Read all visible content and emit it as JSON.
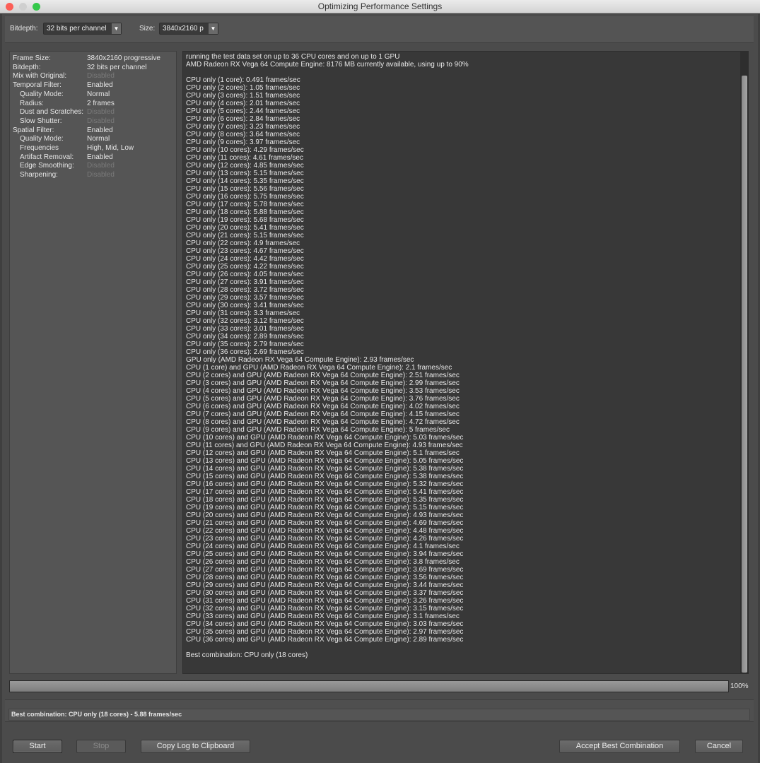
{
  "window": {
    "title": "Optimizing Performance Settings"
  },
  "toolbar": {
    "bitdepth_label": "Bitdepth:",
    "bitdepth_value": "32 bits per channel",
    "size_label": "Size:",
    "size_value": "3840x2160 p"
  },
  "settings": [
    {
      "key": "Frame Size:",
      "value": "3840x2160 progressive",
      "sub": false,
      "disabled": false
    },
    {
      "key": "Bitdepth:",
      "value": "32 bits per channel",
      "sub": false,
      "disabled": false
    },
    {
      "key": "Mix with Original:",
      "value": "Disabled",
      "sub": false,
      "disabled": true
    },
    {
      "key": "Temporal Filter:",
      "value": "Enabled",
      "sub": false,
      "disabled": false
    },
    {
      "key": "Quality Mode:",
      "value": "Normal",
      "sub": true,
      "disabled": false
    },
    {
      "key": "Radius:",
      "value": "2 frames",
      "sub": true,
      "disabled": false
    },
    {
      "key": "Dust and Scratches:",
      "value": "Disabled",
      "sub": true,
      "disabled": true
    },
    {
      "key": "Slow Shutter:",
      "value": "Disabled",
      "sub": true,
      "disabled": true
    },
    {
      "key": "Spatial Filter:",
      "value": "Enabled",
      "sub": false,
      "disabled": false
    },
    {
      "key": "Quality Mode:",
      "value": "Normal",
      "sub": true,
      "disabled": false
    },
    {
      "key": "Frequencies",
      "value": "High, Mid, Low",
      "sub": true,
      "disabled": false
    },
    {
      "key": "Artifact Removal:",
      "value": "Enabled",
      "sub": true,
      "disabled": false
    },
    {
      "key": "Edge Smoothing:",
      "value": "Disabled",
      "sub": true,
      "disabled": true
    },
    {
      "key": "Sharpening:",
      "value": "Disabled",
      "sub": true,
      "disabled": true
    }
  ],
  "log": {
    "lines": [
      "running the test data set on up to 36 CPU cores and on up to 1 GPU",
      "AMD Radeon RX Vega 64 Compute Engine: 8176 MB currently available, using up to 90%",
      "",
      "CPU only (1 core): 0.491 frames/sec",
      "CPU only (2 cores): 1.05 frames/sec",
      "CPU only (3 cores): 1.51 frames/sec",
      "CPU only (4 cores): 2.01 frames/sec",
      "CPU only (5 cores): 2.44 frames/sec",
      "CPU only (6 cores): 2.84 frames/sec",
      "CPU only (7 cores): 3.23 frames/sec",
      "CPU only (8 cores): 3.64 frames/sec",
      "CPU only (9 cores): 3.97 frames/sec",
      "CPU only (10 cores): 4.29 frames/sec",
      "CPU only (11 cores): 4.61 frames/sec",
      "CPU only (12 cores): 4.85 frames/sec",
      "CPU only (13 cores): 5.15 frames/sec",
      "CPU only (14 cores): 5.35 frames/sec",
      "CPU only (15 cores): 5.56 frames/sec",
      "CPU only (16 cores): 5.75 frames/sec",
      "CPU only (17 cores): 5.78 frames/sec",
      "CPU only (18 cores): 5.88 frames/sec",
      "CPU only (19 cores): 5.68 frames/sec",
      "CPU only (20 cores): 5.41 frames/sec",
      "CPU only (21 cores): 5.15 frames/sec",
      "CPU only (22 cores): 4.9 frames/sec",
      "CPU only (23 cores): 4.67 frames/sec",
      "CPU only (24 cores): 4.42 frames/sec",
      "CPU only (25 cores): 4.22 frames/sec",
      "CPU only (26 cores): 4.05 frames/sec",
      "CPU only (27 cores): 3.91 frames/sec",
      "CPU only (28 cores): 3.72 frames/sec",
      "CPU only (29 cores): 3.57 frames/sec",
      "CPU only (30 cores): 3.41 frames/sec",
      "CPU only (31 cores): 3.3 frames/sec",
      "CPU only (32 cores): 3.12 frames/sec",
      "CPU only (33 cores): 3.01 frames/sec",
      "CPU only (34 cores): 2.89 frames/sec",
      "CPU only (35 cores): 2.79 frames/sec",
      "CPU only (36 cores): 2.69 frames/sec",
      "GPU only (AMD Radeon RX Vega 64 Compute Engine): 2.93 frames/sec",
      "CPU (1 core) and GPU (AMD Radeon RX Vega 64 Compute Engine): 2.1 frames/sec",
      "CPU (2 cores) and GPU (AMD Radeon RX Vega 64 Compute Engine): 2.51 frames/sec",
      "CPU (3 cores) and GPU (AMD Radeon RX Vega 64 Compute Engine): 2.99 frames/sec",
      "CPU (4 cores) and GPU (AMD Radeon RX Vega 64 Compute Engine): 3.53 frames/sec",
      "CPU (5 cores) and GPU (AMD Radeon RX Vega 64 Compute Engine): 3.76 frames/sec",
      "CPU (6 cores) and GPU (AMD Radeon RX Vega 64 Compute Engine): 4.02 frames/sec",
      "CPU (7 cores) and GPU (AMD Radeon RX Vega 64 Compute Engine): 4.15 frames/sec",
      "CPU (8 cores) and GPU (AMD Radeon RX Vega 64 Compute Engine): 4.72 frames/sec",
      "CPU (9 cores) and GPU (AMD Radeon RX Vega 64 Compute Engine): 5 frames/sec",
      "CPU (10 cores) and GPU (AMD Radeon RX Vega 64 Compute Engine): 5.03 frames/sec",
      "CPU (11 cores) and GPU (AMD Radeon RX Vega 64 Compute Engine): 4.93 frames/sec",
      "CPU (12 cores) and GPU (AMD Radeon RX Vega 64 Compute Engine): 5.1 frames/sec",
      "CPU (13 cores) and GPU (AMD Radeon RX Vega 64 Compute Engine): 5.05 frames/sec",
      "CPU (14 cores) and GPU (AMD Radeon RX Vega 64 Compute Engine): 5.38 frames/sec",
      "CPU (15 cores) and GPU (AMD Radeon RX Vega 64 Compute Engine): 5.38 frames/sec",
      "CPU (16 cores) and GPU (AMD Radeon RX Vega 64 Compute Engine): 5.32 frames/sec",
      "CPU (17 cores) and GPU (AMD Radeon RX Vega 64 Compute Engine): 5.41 frames/sec",
      "CPU (18 cores) and GPU (AMD Radeon RX Vega 64 Compute Engine): 5.35 frames/sec",
      "CPU (19 cores) and GPU (AMD Radeon RX Vega 64 Compute Engine): 5.15 frames/sec",
      "CPU (20 cores) and GPU (AMD Radeon RX Vega 64 Compute Engine): 4.93 frames/sec",
      "CPU (21 cores) and GPU (AMD Radeon RX Vega 64 Compute Engine): 4.69 frames/sec",
      "CPU (22 cores) and GPU (AMD Radeon RX Vega 64 Compute Engine): 4.48 frames/sec",
      "CPU (23 cores) and GPU (AMD Radeon RX Vega 64 Compute Engine): 4.26 frames/sec",
      "CPU (24 cores) and GPU (AMD Radeon RX Vega 64 Compute Engine): 4.1 frames/sec",
      "CPU (25 cores) and GPU (AMD Radeon RX Vega 64 Compute Engine): 3.94 frames/sec",
      "CPU (26 cores) and GPU (AMD Radeon RX Vega 64 Compute Engine): 3.8 frames/sec",
      "CPU (27 cores) and GPU (AMD Radeon RX Vega 64 Compute Engine): 3.69 frames/sec",
      "CPU (28 cores) and GPU (AMD Radeon RX Vega 64 Compute Engine): 3.56 frames/sec",
      "CPU (29 cores) and GPU (AMD Radeon RX Vega 64 Compute Engine): 3.44 frames/sec",
      "CPU (30 cores) and GPU (AMD Radeon RX Vega 64 Compute Engine): 3.37 frames/sec",
      "CPU (31 cores) and GPU (AMD Radeon RX Vega 64 Compute Engine): 3.26 frames/sec",
      "CPU (32 cores) and GPU (AMD Radeon RX Vega 64 Compute Engine): 3.15 frames/sec",
      "CPU (33 cores) and GPU (AMD Radeon RX Vega 64 Compute Engine): 3.1 frames/sec",
      "CPU (34 cores) and GPU (AMD Radeon RX Vega 64 Compute Engine): 3.03 frames/sec",
      "CPU (35 cores) and GPU (AMD Radeon RX Vega 64 Compute Engine): 2.97 frames/sec",
      "CPU (36 cores) and GPU (AMD Radeon RX Vega 64 Compute Engine): 2.89 frames/sec",
      "",
      "Best combination: CPU only (18 cores)"
    ]
  },
  "progress": {
    "percent": 100,
    "label": "100%"
  },
  "status": {
    "text": "Best combination: CPU only (18 cores) - 5.88 frames/sec"
  },
  "buttons": {
    "start": "Start",
    "stop": "Stop",
    "copy_log": "Copy Log to Clipboard",
    "accept": "Accept Best Combination",
    "cancel": "Cancel"
  },
  "colors": {
    "close": "#fc5f57",
    "minimize": "#d0d0d0",
    "zoom": "#34c84a"
  }
}
